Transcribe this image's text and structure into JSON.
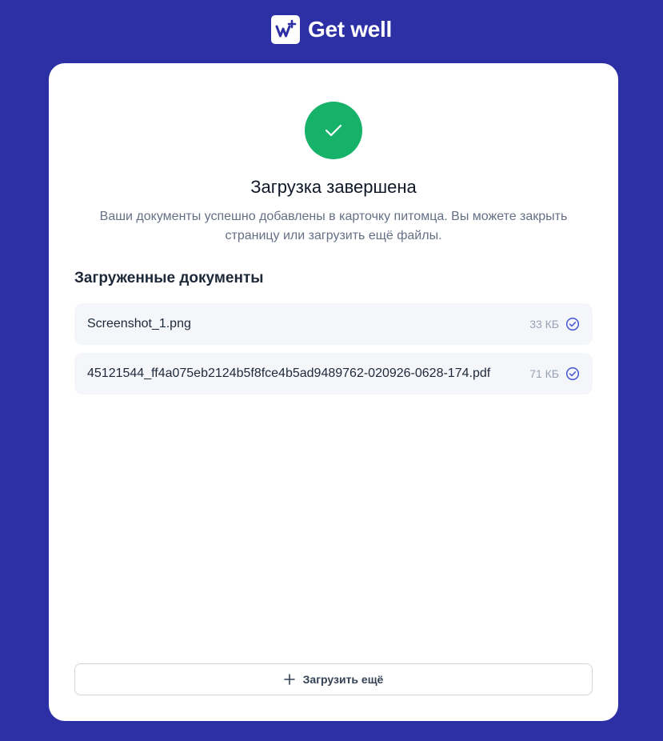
{
  "brand": {
    "name": "Get well",
    "logo_icon": "w-plus-logo-icon"
  },
  "status": {
    "icon": "check-icon",
    "color": "#17b26a",
    "title": "Загрузка завершена",
    "message": "Ваши документы успешно добавлены в карточку питомца. Вы можете закрыть страницу или загрузить ещё файлы."
  },
  "uploaded": {
    "heading": "Загруженные документы",
    "files": [
      {
        "name": "Screenshot_1.png",
        "size": "33 КБ",
        "status_icon": "check-circle-icon"
      },
      {
        "name": "45121544_ff4a075eb2124b5f8fce4b5ad9489762-020926-0628-174.pdf",
        "size": "71 КБ",
        "status_icon": "check-circle-icon"
      }
    ]
  },
  "actions": {
    "upload_more_label": "Загрузить ещё",
    "upload_more_icon": "plus-icon"
  },
  "colors": {
    "background": "#2d30a5",
    "accent": "#4f5bd5",
    "success": "#17b26a"
  }
}
